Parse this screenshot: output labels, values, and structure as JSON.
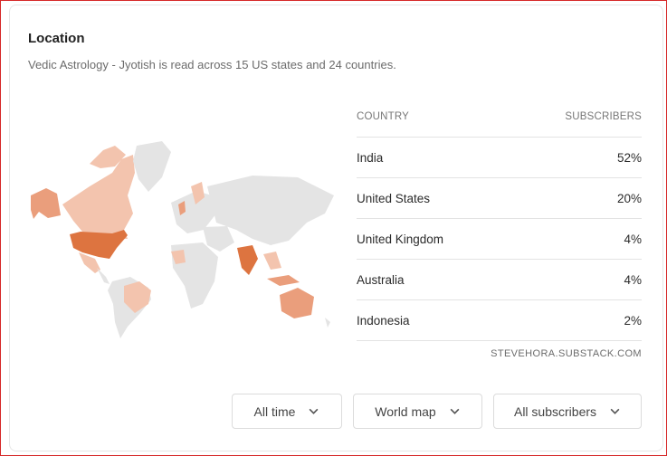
{
  "location": {
    "title": "Location",
    "subtitle": "Vedic Astrology - Jyotish is read across 15 US states and 24 countries."
  },
  "table": {
    "headers": {
      "country": "COUNTRY",
      "subscribers": "SUBSCRIBERS"
    },
    "rows": [
      {
        "country": "India",
        "share": "52%"
      },
      {
        "country": "United States",
        "share": "20%"
      },
      {
        "country": "United Kingdom",
        "share": "4%"
      },
      {
        "country": "Australia",
        "share": "4%"
      },
      {
        "country": "Indonesia",
        "share": "2%"
      }
    ],
    "source": "STEVEHORA.SUBSTACK.COM"
  },
  "controls": {
    "time_range": "All time",
    "view": "World map",
    "audience": "All subscribers"
  },
  "colors": {
    "map_base": "#e4e4e4",
    "map_light": "#f3c4ae",
    "map_mid": "#ea9e7c",
    "map_strong": "#dd7440",
    "card_border": "#e6e6e6"
  },
  "icons": {
    "dropdown": "chevron-down-icon"
  }
}
